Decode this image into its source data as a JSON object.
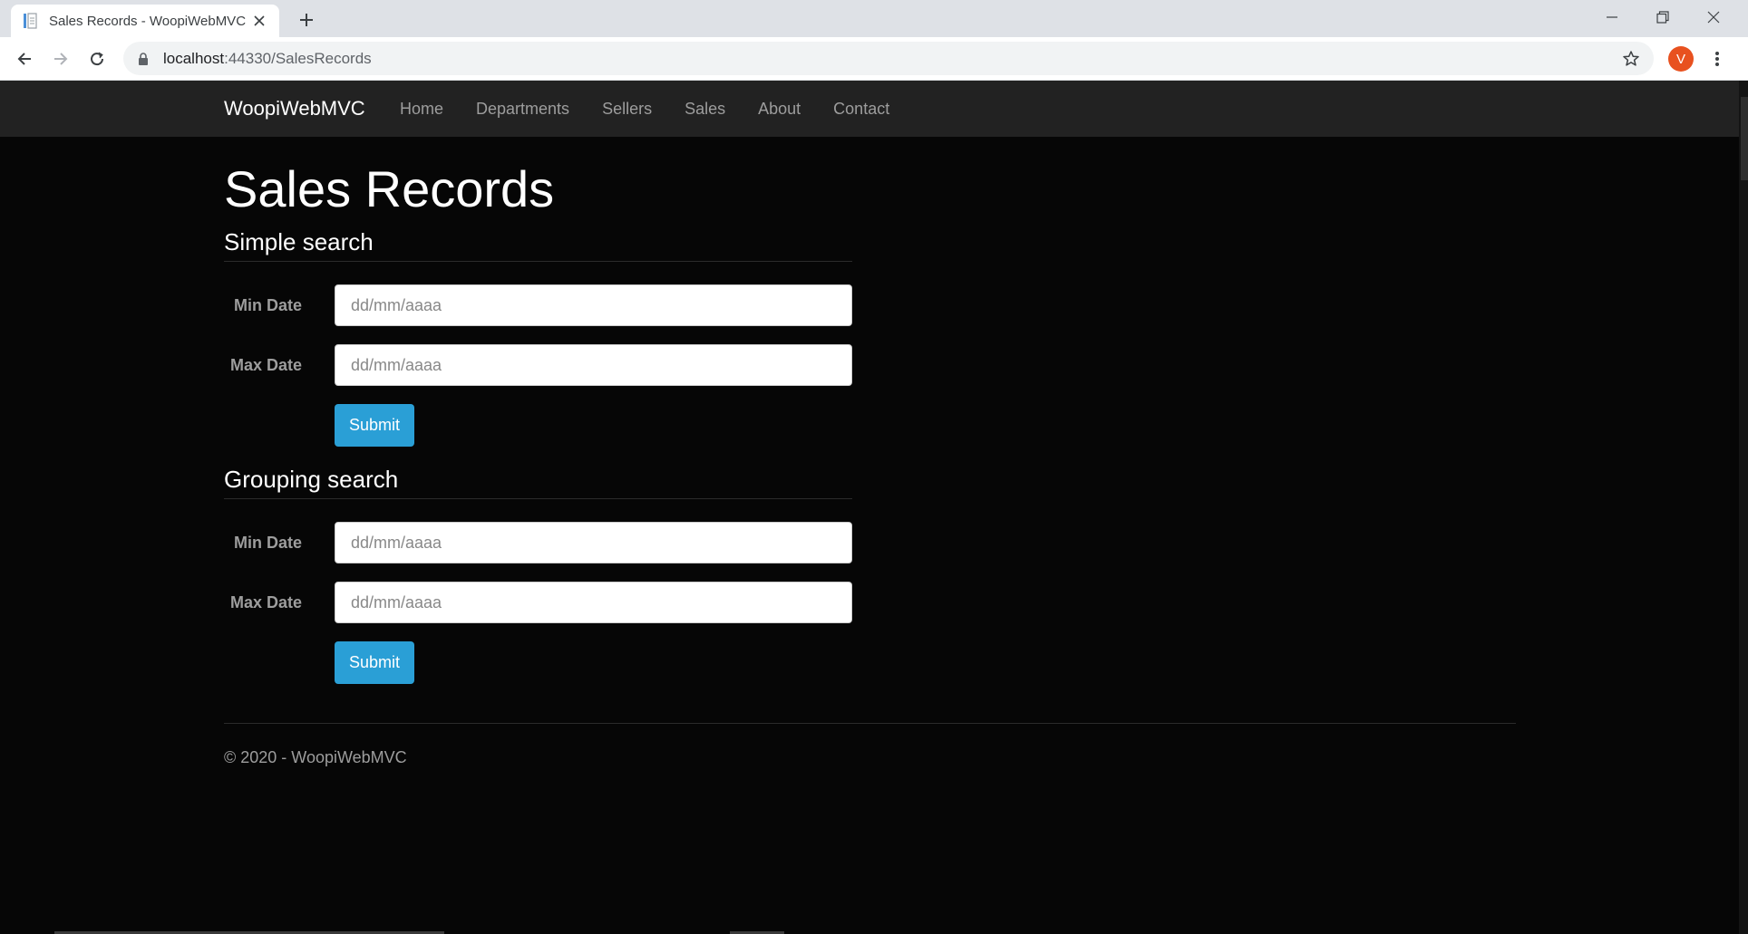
{
  "browser": {
    "tab_title": "Sales Records - WoopiWebMVC",
    "url_host": "localhost",
    "url_path": ":44330/SalesRecords",
    "profile_initial": "V"
  },
  "navbar": {
    "brand": "WoopiWebMVC",
    "links": [
      "Home",
      "Departments",
      "Sellers",
      "Sales",
      "About",
      "Contact"
    ]
  },
  "page": {
    "title": "Sales Records",
    "simple_search": {
      "heading": "Simple search",
      "min_date_label": "Min Date",
      "min_date_placeholder": "dd/mm/aaaa",
      "max_date_label": "Max Date",
      "max_date_placeholder": "dd/mm/aaaa",
      "submit_label": "Submit"
    },
    "grouping_search": {
      "heading": "Grouping search",
      "min_date_label": "Min Date",
      "min_date_placeholder": "dd/mm/aaaa",
      "max_date_label": "Max Date",
      "max_date_placeholder": "dd/mm/aaaa",
      "submit_label": "Submit"
    }
  },
  "footer": {
    "text": "© 2020 - WoopiWebMVC"
  },
  "colors": {
    "page_background": "#060606",
    "navbar_background": "#222222",
    "accent": "#2a9fd6",
    "muted_text": "#9d9d9d",
    "profile_badge": "#e8511f"
  },
  "icons": [
    "page-favicon-icon",
    "close-icon",
    "plus-icon",
    "minimize-icon",
    "restore-icon",
    "window-close-icon",
    "back-arrow-icon",
    "forward-arrow-icon",
    "reload-icon",
    "lock-icon",
    "star-icon",
    "more-vertical-icon"
  ]
}
